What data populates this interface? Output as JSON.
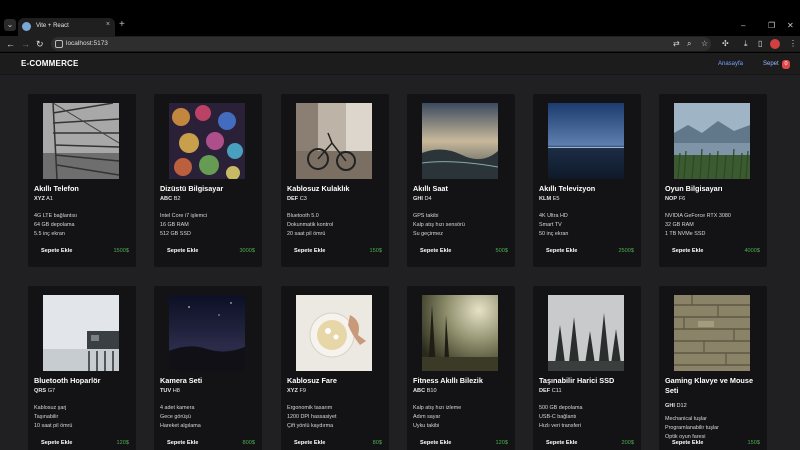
{
  "browser": {
    "tab_title": "Vite + React",
    "tab_close": "×",
    "new_tab": "+",
    "url": "localhost:5173",
    "controls": {
      "minimize": "–",
      "maximize": "❐",
      "close": "✕"
    },
    "nav": {
      "back": "←",
      "forward": "→",
      "reload": "↻"
    }
  },
  "header": {
    "brand": "E-COMMERCE",
    "home_link": "Anasayfa",
    "cart_link": "Sepet",
    "cart_count": "0"
  },
  "products": [
    {
      "title": "Akıllı Telefon",
      "brand": "XYZ",
      "model": "A1",
      "features": [
        "4G LTE bağlantısı",
        "64 GB depolama",
        "5.5 inç ekran"
      ],
      "button": "Sepete Ekle",
      "price": "1500$"
    },
    {
      "title": "Dizüstü Bilgisayar",
      "brand": "ABC",
      "model": "B2",
      "features": [
        "Intel Core i7 işlemci",
        "16 GB RAM",
        "512 GB SSD"
      ],
      "button": "Sepete Ekle",
      "price": "3000$"
    },
    {
      "title": "Kablosuz Kulaklık",
      "brand": "DEF",
      "model": "C3",
      "features": [
        "Bluetooth 5.0",
        "Dokunmatik kontrol",
        "20 saat pil ömrü"
      ],
      "button": "Sepete Ekle",
      "price": "150$"
    },
    {
      "title": "Akıllı Saat",
      "brand": "GHI",
      "model": "D4",
      "features": [
        "GPS takibi",
        "Kalp atış hızı sensörü",
        "Su geçirmez"
      ],
      "button": "Sepete Ekle",
      "price": "500$"
    },
    {
      "title": "Akıllı Televizyon",
      "brand": "KLM",
      "model": "E5",
      "features": [
        "4K Ultra HD",
        "Smart TV",
        "50 inç ekran"
      ],
      "button": "Sepete Ekle",
      "price": "2500$"
    },
    {
      "title": "Oyun Bilgisayarı",
      "brand": "NOP",
      "model": "F6",
      "features": [
        "NVIDIA GeForce RTX 3080",
        "32 GB RAM",
        "1 TB NVMe SSD"
      ],
      "button": "Sepete Ekle",
      "price": "4000$"
    },
    {
      "title": "Bluetooth Hoparlör",
      "brand": "QRS",
      "model": "G7",
      "features": [
        "Kablosuz şarj",
        "Taşınabilir",
        "10 saat pil ömrü"
      ],
      "button": "Sepete Ekle",
      "price": "120$"
    },
    {
      "title": "Kamera Seti",
      "brand": "TUV",
      "model": "H8",
      "features": [
        "4 adet kamera",
        "Gece görüşü",
        "Hareket algılama"
      ],
      "button": "Sepete Ekle",
      "price": "800$"
    },
    {
      "title": "Kablosuz Fare",
      "brand": "XYZ",
      "model": "F9",
      "features": [
        "Ergonomik tasarım",
        "1200 DPI hassasiyet",
        "Çift yönlü kaydırma"
      ],
      "button": "Sepete Ekle",
      "price": "80$"
    },
    {
      "title": "Fitness Akıllı Bilezik",
      "brand": "ABC",
      "model": "B10",
      "features": [
        "Kalp atış hızı izleme",
        "Adım sayar",
        "Uyku takibi"
      ],
      "button": "Sepete Ekle",
      "price": "120$"
    },
    {
      "title": "Taşınabilir Harici SSD",
      "brand": "DEF",
      "model": "C11",
      "features": [
        "500 GB depolama",
        "USB-C bağlantı",
        "Hızlı veri transferi"
      ],
      "button": "Sepete Ekle",
      "price": "200$"
    },
    {
      "title": "Gaming Klavye ve Mouse Seti",
      "brand": "GHI",
      "model": "D12",
      "features": [
        "Mechanical tuşlar",
        "Programlanabilir tuşlar",
        "Optik oyun faresi"
      ],
      "button": "Sepete Ekle",
      "price": "150$"
    }
  ]
}
